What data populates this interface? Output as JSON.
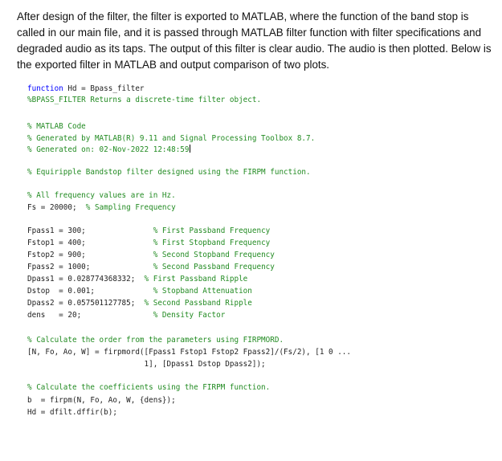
{
  "paragraph": "After design of the filter, the filter is exported to MATLAB, where the function of the band stop is called in our main file, and it is passed through MATLAB filter function with filter specifications and degraded audio as its taps. The output of this filter is clear audio. The audio is then plotted. Below is the exported filter in MATLAB and output comparison of two plots.",
  "code": {
    "l1_kw": "function",
    "l1_rest": " Hd = Bpass_filter",
    "l2": "%BPASS_FILTER Returns a discrete-time filter object.",
    "l3": "% MATLAB Code",
    "l4": "% Generated by MATLAB(R) 9.11 and Signal Processing Toolbox 8.7.",
    "l5": "% Generated on: 02-Nov-2022 12:48:59",
    "l6": "% Equiripple Bandstop filter designed using the FIRPM function.",
    "l7": "% All frequency values are in Hz.",
    "l8_code": "Fs = 20000;  ",
    "l8_cm": "% Sampling Frequency",
    "l9_code": "Fpass1 = 300;               ",
    "l9_cm": "% First Passband Frequency",
    "l10_code": "Fstop1 = 400;               ",
    "l10_cm": "% First Stopband Frequency",
    "l11_code": "Fstop2 = 900;               ",
    "l11_cm": "% Second Stopband Frequency",
    "l12_code": "Fpass2 = 1000;              ",
    "l12_cm": "% Second Passband Frequency",
    "l13_code": "Dpass1 = 0.028774368332;  ",
    "l13_cm": "% First Passband Ripple",
    "l14_code": "Dstop  = 0.001;             ",
    "l14_cm": "% Stopband Attenuation",
    "l15_code": "Dpass2 = 0.057501127785;  ",
    "l15_cm": "% Second Passband Ripple",
    "l16_code": "dens   = 20;                ",
    "l16_cm": "% Density Factor",
    "l17": "% Calculate the order from the parameters using FIRPMORD.",
    "l18": "[N, Fo, Ao, W] = firpmord([Fpass1 Fstop1 Fstop2 Fpass2]/(Fs/2), [1 0 ...",
    "l19": "                          1], [Dpass1 Dstop Dpass2]);",
    "l20": "% Calculate the coefficients using the FIRPM function.",
    "l21": "b  = firpm(N, Fo, Ao, W, {dens});",
    "l22": "Hd = dfilt.dffir(b);"
  }
}
